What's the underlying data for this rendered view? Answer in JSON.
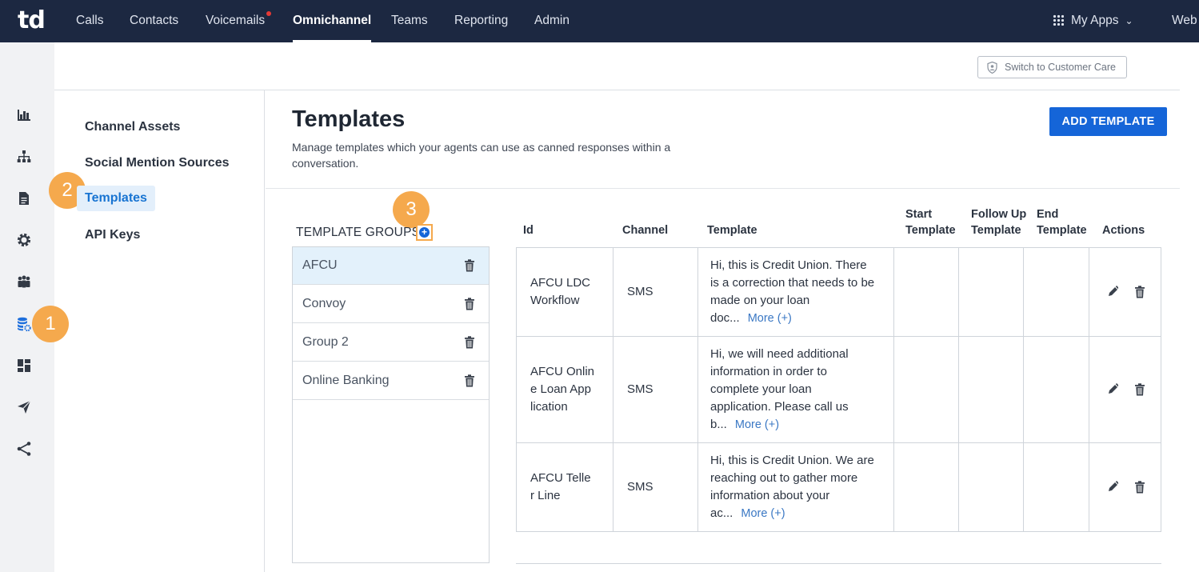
{
  "app": {
    "logo": "td"
  },
  "topnav": {
    "items": [
      {
        "label": "Calls"
      },
      {
        "label": "Contacts"
      },
      {
        "label": "Voicemails"
      },
      {
        "label": "Omnichannel"
      },
      {
        "label": "Teams"
      },
      {
        "label": "Reporting"
      },
      {
        "label": "Admin"
      }
    ],
    "active": "Omnichannel",
    "my_apps": "My Apps",
    "web": "Web"
  },
  "rail": {
    "icons": [
      "bar-chart-icon",
      "org-chart-icon",
      "document-icon",
      "gear-icon",
      "people-icon",
      "database-settings-icon",
      "dashboard-icon",
      "send-icon",
      "share-icon"
    ],
    "active": "database-settings-icon"
  },
  "callouts": {
    "one": "1",
    "two": "2",
    "three": "3"
  },
  "header": {
    "switch_label": "Switch to Customer Care"
  },
  "subnav": {
    "items": [
      {
        "label": "Channel Assets"
      },
      {
        "label": "Social Mention Sources"
      },
      {
        "label": "Templates"
      },
      {
        "label": "API Keys"
      }
    ],
    "active": "Templates"
  },
  "main": {
    "title": "Templates",
    "description": "Manage templates which your agents can use as canned responses within a conversation.",
    "add_button": "ADD TEMPLATE"
  },
  "groups": {
    "label": "TEMPLATE GROUPS",
    "add_symbol": "+",
    "items": [
      {
        "name": "AFCU"
      },
      {
        "name": "Convoy"
      },
      {
        "name": "Group 2"
      },
      {
        "name": "Online Banking"
      }
    ],
    "selected": "AFCU"
  },
  "table": {
    "columns": {
      "id": "Id",
      "channel": "Channel",
      "template": "Template",
      "start_1": "Start",
      "start_2": "Template",
      "follow_1": "Follow Up",
      "follow_2": "Template",
      "end_1": "End",
      "end_2": "Template",
      "actions": "Actions"
    },
    "rows": [
      {
        "id_1": "AFCU LDC",
        "id_2": "Workflow",
        "channel": "SMS",
        "t1": "Hi, this is Credit Union. There",
        "t2": "is a correction that needs to be",
        "t3": "made on your loan",
        "t4": "doc...",
        "more": "More (+)"
      },
      {
        "id_1": "AFCU Onlin",
        "id_2": "e Loan App",
        "id_3": "lication",
        "channel": "SMS",
        "t1": "Hi, we will need additional",
        "t2": "information in order to",
        "t3": "complete your loan",
        "t4": "application. Please call us",
        "t5": "b...",
        "more": "More (+)"
      },
      {
        "id_1": "AFCU Telle",
        "id_2": "r Line",
        "channel": "SMS",
        "t1": "Hi, this is Credit Union. We are",
        "t2": "reaching out to gather more",
        "t3": "information about your",
        "t4": "ac...",
        "more": "More (+)"
      }
    ]
  },
  "colors": {
    "nav_bg": "#1c2841",
    "accent": "#1565d8",
    "callout": "#f5a94d",
    "selected_bg": "#e3f1fb"
  }
}
